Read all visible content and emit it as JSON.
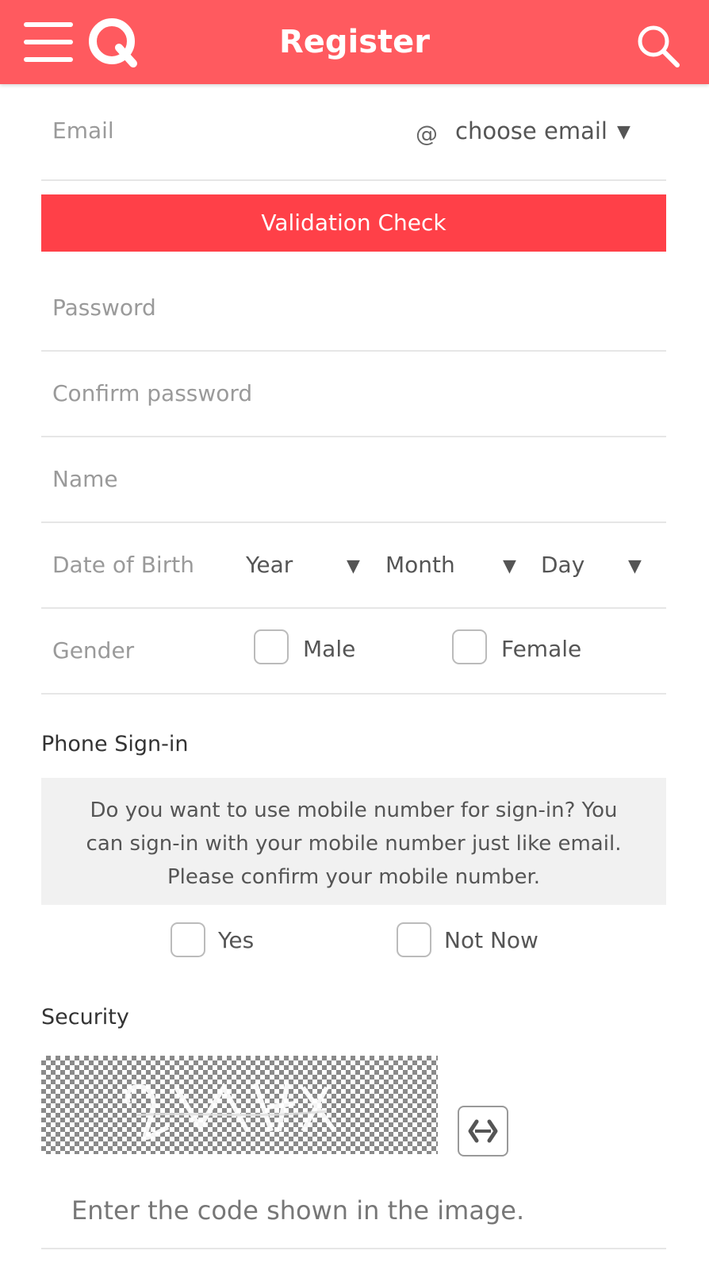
{
  "header": {
    "title": "Register",
    "brand_color": "#ff5a5f"
  },
  "email": {
    "placeholder": "Email",
    "at": "@",
    "domain_select": "choose email"
  },
  "validation_button": "Validation Check",
  "password": {
    "placeholder": "Password"
  },
  "confirm_password": {
    "placeholder": "Confirm password"
  },
  "name": {
    "placeholder": "Name"
  },
  "dob": {
    "label": "Date of Birth",
    "year": "Year",
    "month": "Month",
    "day": "Day"
  },
  "gender": {
    "label": "Gender",
    "options": [
      "Male",
      "Female"
    ]
  },
  "phone_signin": {
    "title": "Phone Sign-in",
    "info_lines": [
      "Do you want to use mobile number for sign-in?  You",
      "can sign-in with your mobile number just like email.",
      "Please confirm your mobile number."
    ],
    "options": [
      "Yes",
      "Not Now"
    ]
  },
  "security": {
    "title": "Security",
    "captcha_placeholder": "Enter the code shown in the image."
  },
  "icons": [
    "menu-icon",
    "q-logo-icon",
    "search-icon",
    "chevron-down-icon",
    "refresh-icon"
  ]
}
